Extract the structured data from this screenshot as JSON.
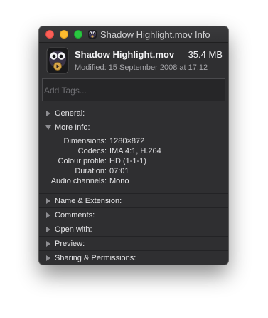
{
  "window": {
    "title": "Shadow Highlight.mov Info",
    "title_icon": "mov-file-icon"
  },
  "file": {
    "name": "Shadow Highlight.mov",
    "size": "35.4 MB",
    "modified": "Modified: 15 September 2008 at 17:12",
    "icon": "quicktime-movie-icon"
  },
  "tags": {
    "placeholder": "Add Tags..."
  },
  "sections": {
    "general": {
      "label": "General:",
      "expanded": false
    },
    "more_info": {
      "label": "More Info:",
      "expanded": true
    },
    "name_extension": {
      "label": "Name & Extension:",
      "expanded": false
    },
    "comments": {
      "label": "Comments:",
      "expanded": false
    },
    "open_with": {
      "label": "Open with:",
      "expanded": false
    },
    "preview": {
      "label": "Preview:",
      "expanded": false
    },
    "sharing": {
      "label": "Sharing & Permissions:",
      "expanded": false
    }
  },
  "more_info": [
    {
      "key": "Dimensions:",
      "value": "1280×872"
    },
    {
      "key": "Codecs:",
      "value": "IMA 4:1, H.264"
    },
    {
      "key": "Colour profile:",
      "value": "HD (1-1-1)"
    },
    {
      "key": "Duration:",
      "value": "07:01"
    },
    {
      "key": "Audio channels:",
      "value": "Mono"
    }
  ],
  "colors": {
    "window_bg": "#2f2f31",
    "close": "#fc5f57",
    "minimize": "#fdbc2e",
    "zoom": "#29c840"
  }
}
